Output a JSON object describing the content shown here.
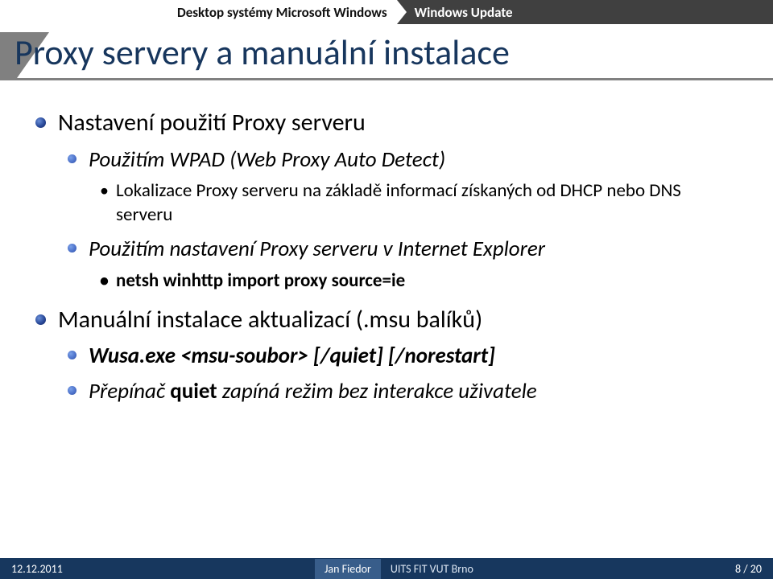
{
  "breadcrumb": {
    "course": "Desktop systémy Microsoft Windows",
    "section": "Windows Update"
  },
  "title": "Proxy servery a manuální instalace",
  "bullets": {
    "b1": "Nastavení použití Proxy serveru",
    "b1a": "Použitím WPAD (Web Proxy Auto Detect)",
    "b1a1": "Lokalizace Proxy serveru na základě informací získaných od DHCP nebo DNS serveru",
    "b1b": "Použitím nastavení Proxy serveru v Internet Explorer",
    "b1b1": "netsh winhttp import proxy source=ie",
    "b2": "Manuální instalace aktualizací (.msu balíků)",
    "b2a": "Wusa.exe <msu-soubor> [/quiet] [/norestart]",
    "b2b_pre": "Přepínač ",
    "b2b_key": "quiet",
    "b2b_post": " zapíná režim bez interakce uživatele"
  },
  "footer": {
    "date": "12.12.2011",
    "author": "Jan Fiedor",
    "institution": "UITS FIT VUT Brno",
    "page": "8 / 20"
  }
}
